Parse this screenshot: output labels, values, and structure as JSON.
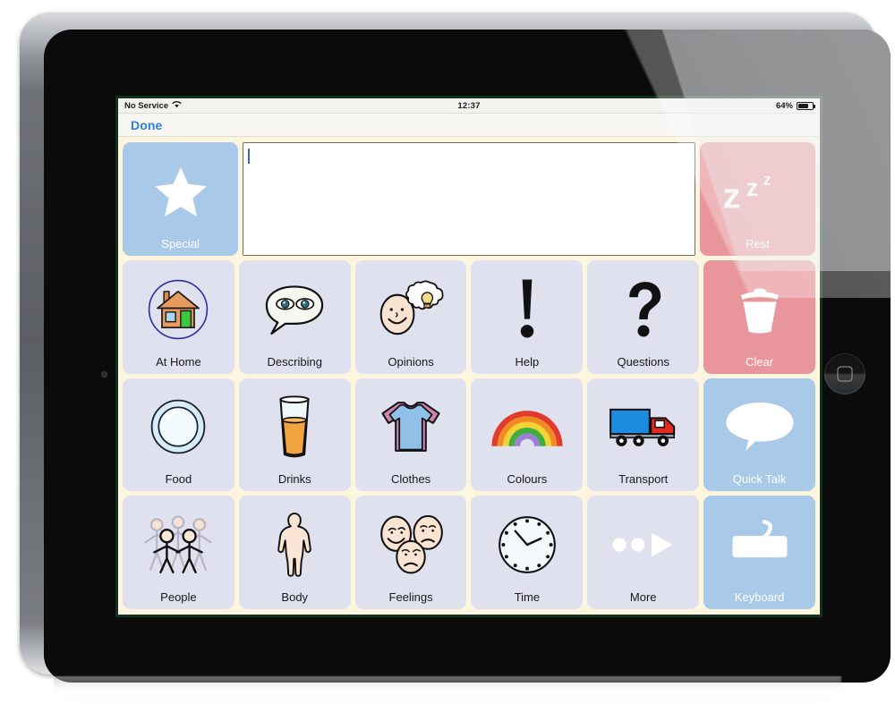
{
  "device": {
    "name": "iPad",
    "home_button": "home-button",
    "camera": "front-camera"
  },
  "status_bar": {
    "carrier": "No Service",
    "wifi_icon": "wifi-icon",
    "time": "12:37",
    "battery_percent": "64%",
    "battery_level": 64,
    "battery_icon": "battery-icon"
  },
  "nav_bar": {
    "done_label": "Done"
  },
  "message_box": {
    "value": "",
    "placeholder": ""
  },
  "colors": {
    "app_background": "#fdf5de",
    "cell_default": "#dfe1ee",
    "cell_blue": "#a8c9e8",
    "cell_salmon": "#e8969b",
    "screen_border": "#12301f",
    "done_link": "#2f7fd4",
    "caret": "#3f62c8"
  },
  "grid": {
    "rows": [
      {
        "cells": [
          {
            "label": "Special",
            "icon": "star-icon",
            "style": "blue"
          },
          {
            "label": "",
            "icon": "message-box",
            "style": "messagebox"
          },
          {
            "label": "Rest",
            "icon": "zzz-icon",
            "style": "salmon"
          }
        ]
      },
      {
        "cells": [
          {
            "label": "At Home",
            "icon": "house-icon",
            "style": "default"
          },
          {
            "label": "Describing",
            "icon": "speech-bubble-eyes-icon",
            "style": "default"
          },
          {
            "label": "Opinions",
            "icon": "face-thought-bulb-icon",
            "style": "default"
          },
          {
            "label": "Help",
            "icon": "exclamation-mark-icon",
            "style": "default"
          },
          {
            "label": "Questions",
            "icon": "question-mark-icon",
            "style": "default"
          },
          {
            "label": "Clear",
            "icon": "trash-can-icon",
            "style": "salmon"
          }
        ]
      },
      {
        "cells": [
          {
            "label": "Food",
            "icon": "plate-icon",
            "style": "default"
          },
          {
            "label": "Drinks",
            "icon": "glass-juice-icon",
            "style": "default"
          },
          {
            "label": "Clothes",
            "icon": "tshirt-icon",
            "style": "default"
          },
          {
            "label": "Colours",
            "icon": "rainbow-icon",
            "style": "default"
          },
          {
            "label": "Transport",
            "icon": "lorry-icon",
            "style": "default"
          },
          {
            "label": "Quick Talk",
            "icon": "speech-bubble-icon",
            "style": "blue"
          }
        ]
      },
      {
        "cells": [
          {
            "label": "People",
            "icon": "group-of-people-icon",
            "style": "default"
          },
          {
            "label": "Body",
            "icon": "body-outline-icon",
            "style": "default"
          },
          {
            "label": "Feelings",
            "icon": "three-faces-icon",
            "style": "default"
          },
          {
            "label": "Time",
            "icon": "clock-icon",
            "style": "default"
          },
          {
            "label": "More",
            "icon": "more-arrow-icon",
            "style": "default"
          },
          {
            "label": "Keyboard",
            "icon": "keyboard-icon",
            "style": "blue"
          }
        ]
      }
    ]
  }
}
